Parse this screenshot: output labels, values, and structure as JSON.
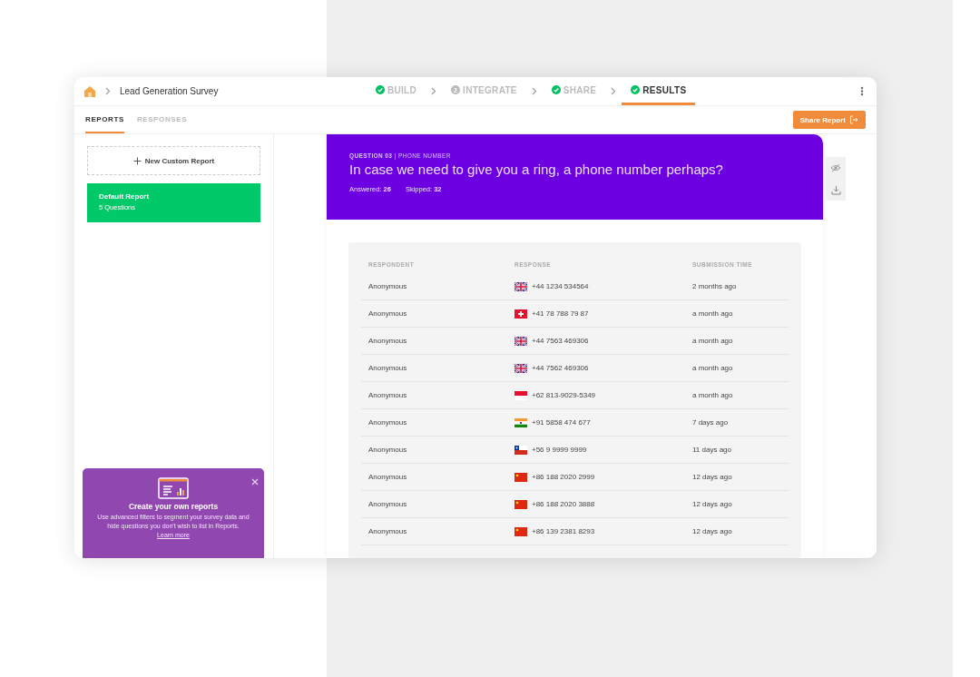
{
  "breadcrumb": {
    "title": "Lead Generation Survey"
  },
  "steps": [
    {
      "label": "BUILD",
      "kind": "done",
      "selected": false
    },
    {
      "label": "INTEGRATE",
      "kind": "number",
      "number": "2",
      "selected": false
    },
    {
      "label": "SHARE",
      "kind": "done",
      "selected": false
    },
    {
      "label": "RESULTS",
      "kind": "done",
      "selected": true
    }
  ],
  "tabs": [
    {
      "label": "REPORTS",
      "selected": true
    },
    {
      "label": "RESPONSES",
      "selected": false
    }
  ],
  "share_button": "Share Report",
  "sidebar": {
    "new_report": "New Custom Report",
    "reports": [
      {
        "title": "Default Report",
        "subtitle": "5 Questions",
        "selected": true
      }
    ]
  },
  "tip": {
    "title": "Create your own reports",
    "body": "Use advanced filters to segment your survey data and hide questions you don't wish to list in Reports.",
    "link": "Learn more"
  },
  "question": {
    "label": "**QUESTION 03** | PHONE NUMBER",
    "text": "In case we need to give you a ring, a phone number perhaps?",
    "answered": "Answered: **26**",
    "skipped": "Skipped: **32**"
  },
  "table": {
    "columns": [
      "RESPONDENT",
      "RESPONSE",
      "SUBMISSION TIME"
    ],
    "rows": [
      {
        "respondent": "Anonymous",
        "kind": "gb",
        "response": "+44 1234 534564",
        "time": "2 months ago"
      },
      {
        "respondent": "Anonymous",
        "kind": "ch",
        "response": "+41 78 788 79 87",
        "time": "a month ago"
      },
      {
        "respondent": "Anonymous",
        "kind": "gb",
        "response": "+44 7563 469306",
        "time": "a month ago"
      },
      {
        "respondent": "Anonymous",
        "kind": "gb",
        "response": "+44 7562 469306",
        "time": "a month ago"
      },
      {
        "respondent": "Anonymous",
        "kind": "id",
        "response": "+62 813-9029-5349",
        "time": "a month ago"
      },
      {
        "respondent": "Anonymous",
        "kind": "in",
        "response": "+91 5858 474 677",
        "time": "7 days ago"
      },
      {
        "respondent": "Anonymous",
        "kind": "cl",
        "response": "+56 9 9999 9999",
        "time": "11 days ago"
      },
      {
        "respondent": "Anonymous",
        "kind": "cn",
        "response": "+86 188 2020 2999",
        "time": "12 days ago"
      },
      {
        "respondent": "Anonymous",
        "kind": "cn",
        "response": "+86 188 2020 3888",
        "time": "12 days ago"
      },
      {
        "respondent": "Anonymous",
        "kind": "cn",
        "response": "+86 139 2381 8293",
        "time": "12 days ago"
      }
    ]
  }
}
